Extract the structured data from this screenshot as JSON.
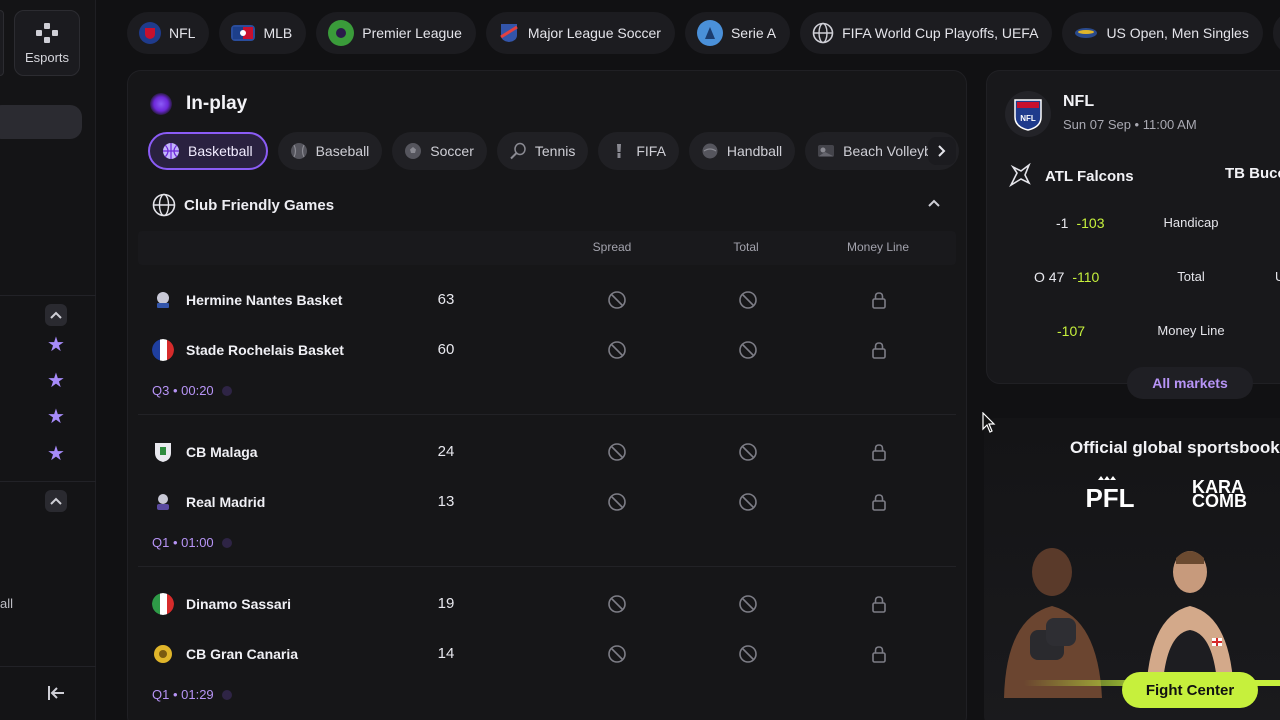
{
  "sidebar": {
    "esports_label": "Esports",
    "partial_item_label": "all"
  },
  "leagues": [
    {
      "label": "NFL",
      "icon": "nfl-shield-icon",
      "color": "#1f3b8c"
    },
    {
      "label": "MLB",
      "icon": "mlb-icon",
      "color": "#2a4d9c"
    },
    {
      "label": "Premier League",
      "icon": "premier-league-icon",
      "color": "#3a9b3a"
    },
    {
      "label": "Major League Soccer",
      "icon": "mls-icon",
      "color": "#3355aa"
    },
    {
      "label": "Serie A",
      "icon": "serie-a-icon",
      "color": "#4a90d9"
    },
    {
      "label": "FIFA World Cup Playoffs, UEFA",
      "icon": "globe-icon",
      "color": "#cfcfd6"
    },
    {
      "label": "US Open, Men Singles",
      "icon": "us-open-icon",
      "color": "#e0b52a"
    }
  ],
  "inplay": {
    "title": "In-play",
    "sports": [
      {
        "label": "Basketball",
        "active": true
      },
      {
        "label": "Baseball",
        "active": false
      },
      {
        "label": "Soccer",
        "active": false
      },
      {
        "label": "Tennis",
        "active": false
      },
      {
        "label": "FIFA",
        "active": false
      },
      {
        "label": "Handball",
        "active": false
      },
      {
        "label": "Beach Volleyball",
        "active": false
      }
    ],
    "competition": "Club Friendly Games",
    "columns": {
      "spread": "Spread",
      "total": "Total",
      "moneyline": "Money Line"
    },
    "matches": [
      {
        "home": "Hermine Nantes Basket",
        "home_score": "63",
        "away": "Stade Rochelais Basket",
        "away_score": "60",
        "time": "Q3 • 00:20"
      },
      {
        "home": "CB Malaga",
        "home_score": "24",
        "away": "Real Madrid",
        "away_score": "13",
        "time": "Q1 • 01:00"
      },
      {
        "home": "Dinamo Sassari",
        "home_score": "19",
        "away": "CB Gran Canaria",
        "away_score": "14",
        "time": "Q1 • 01:29"
      }
    ]
  },
  "nfl_card": {
    "league": "NFL",
    "date": "Sun 07 Sep • 11:00 AM",
    "home_team": "ATL Falcons",
    "away_team": "TB Bucc",
    "handicap": {
      "line": "-1",
      "odds": "-103",
      "label": "Handicap"
    },
    "total": {
      "line": "O 47",
      "odds": "-110",
      "label": "Total",
      "away_partial": "U"
    },
    "moneyline": {
      "odds": "-107",
      "label": "Money Line"
    },
    "all_markets": "All markets"
  },
  "promo": {
    "title": "Official global sportsbook",
    "brand_1": "PFL",
    "brand_2_line1": "KARA",
    "brand_2_line2": "COMB",
    "cta": "Fight Center"
  },
  "colors": {
    "accent_purple": "#8b5cf6",
    "odds_green": "#c6f03c",
    "time_purple": "#b794f6"
  }
}
